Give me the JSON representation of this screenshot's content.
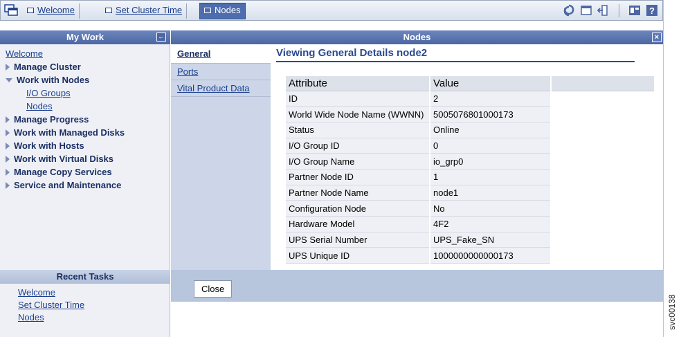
{
  "top_tabs": [
    {
      "label": "Welcome",
      "active": false
    },
    {
      "label": "Set Cluster Time",
      "active": false
    },
    {
      "label": "Nodes",
      "active": true
    }
  ],
  "toolbar_icons": [
    "refresh-icon",
    "window-icon",
    "logout-icon",
    "task-icon",
    "help-icon"
  ],
  "my_work": {
    "title": "My Work",
    "nav": [
      {
        "label": "Welcome",
        "kind": "link"
      },
      {
        "label": "Manage Cluster",
        "kind": "category",
        "expanded": false
      },
      {
        "label": "Work with Nodes",
        "kind": "category",
        "expanded": true
      },
      {
        "label": "I/O Groups",
        "kind": "sub"
      },
      {
        "label": "Nodes",
        "kind": "sub"
      },
      {
        "label": "Manage Progress",
        "kind": "category",
        "expanded": false
      },
      {
        "label": "Work with Managed Disks",
        "kind": "category",
        "expanded": false
      },
      {
        "label": "Work with Hosts",
        "kind": "category",
        "expanded": false
      },
      {
        "label": "Work with Virtual Disks",
        "kind": "category",
        "expanded": false
      },
      {
        "label": "Manage Copy Services",
        "kind": "category",
        "expanded": false
      },
      {
        "label": "Service and Maintenance",
        "kind": "category",
        "expanded": false
      }
    ]
  },
  "recent_tasks": {
    "title": "Recent Tasks",
    "items": [
      "Welcome",
      "Set Cluster Time",
      "Nodes"
    ]
  },
  "panel": {
    "title": "Nodes",
    "tabs": [
      {
        "label": "General",
        "active": true
      },
      {
        "label": "Ports",
        "active": false
      },
      {
        "label": "Vital Product Data",
        "active": false
      }
    ],
    "view_title": "Viewing General Details node2",
    "table": {
      "headers": [
        "Attribute",
        "Value"
      ],
      "rows": [
        [
          "ID",
          "2"
        ],
        [
          "World Wide Node Name (WWNN)",
          "5005076801000173"
        ],
        [
          "Status",
          "Online"
        ],
        [
          "I/O Group ID",
          "0"
        ],
        [
          "I/O Group Name",
          "io_grp0"
        ],
        [
          "Partner Node ID",
          "1"
        ],
        [
          "Partner Node Name",
          "node1"
        ],
        [
          "Configuration Node",
          "No"
        ],
        [
          "Hardware Model",
          "4F2"
        ],
        [
          "UPS Serial Number",
          "UPS_Fake_SN"
        ],
        [
          "UPS Unique ID",
          "1000000000000173"
        ]
      ]
    },
    "close_label": "Close"
  },
  "figure_code": "svc00138",
  "colors": {
    "header_blue": "#4b66a3",
    "link_blue": "#1b3f8f",
    "panel_bg": "#b7c5dd"
  }
}
